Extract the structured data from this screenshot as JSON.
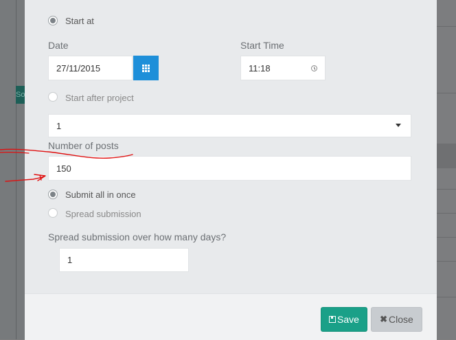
{
  "form": {
    "start_at_label": "Start at",
    "date_label": "Date",
    "date_value": "27/11/2015",
    "start_time_label": "Start Time",
    "start_time_value": "11:18",
    "start_after_label": "Start after project",
    "project_select_value": "1",
    "posts_label": "Number of posts",
    "posts_value": "150",
    "submit_all_label": "Submit all in once",
    "spread_label": "Spread submission",
    "spread_days_label": "Spread submission over how many days?",
    "spread_days_value": "1"
  },
  "footer": {
    "save_label": "Save",
    "close_label": "Close"
  },
  "background": {
    "partial_button_text": "So"
  },
  "colors": {
    "accent_blue": "#1e8fd9",
    "save_green": "#1aa088",
    "annotation_red": "#e01010"
  }
}
